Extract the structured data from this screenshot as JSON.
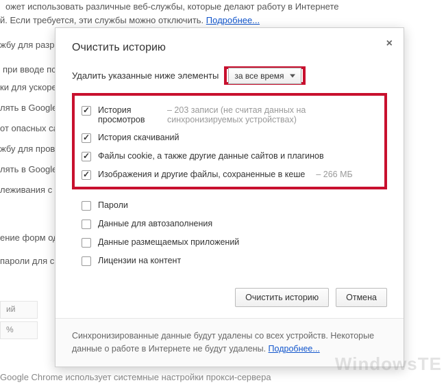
{
  "background": {
    "line1": "ожет использовать различные веб-службы, которые делают работу в Интернете",
    "line2_a": "й. Если требуется, эти службы можно отключить.",
    "line2_link": "Подробнее...",
    "side1": "жбу для разр",
    "side2": "при вводе пс",
    "side3": "ки для ускоре",
    "side4": "лять в Google",
    "side5": "от опасных са",
    "side6": "жбу для пров",
    "side7": "лять в Google",
    "side8": "леживания с",
    "side9": "ение форм од",
    "side10": "пароли для с",
    "row1": "ий",
    "row2": "%",
    "bottom": "Google Chrome использует системные настройки прокси-сервера"
  },
  "dialog": {
    "title": "Очистить историю",
    "delete_label": "Удалить указанные ниже элементы",
    "time_range": "за все время",
    "items": [
      {
        "checked": true,
        "label": "История просмотров",
        "sub": "– 203 записи (не считая данных на синхронизируемых устройствах)"
      },
      {
        "checked": true,
        "label": "История скачиваний",
        "sub": ""
      },
      {
        "checked": true,
        "label": "Файлы cookie, а также другие данные сайтов и плагинов",
        "sub": ""
      },
      {
        "checked": true,
        "label": "Изображения и другие файлы, сохраненные в кеше",
        "sub": "– 266 МБ"
      }
    ],
    "plain_items": [
      {
        "checked": false,
        "label": "Пароли"
      },
      {
        "checked": false,
        "label": "Данные для автозаполнения"
      },
      {
        "checked": false,
        "label": "Данные размещаемых приложений"
      },
      {
        "checked": false,
        "label": "Лицензии на контент"
      }
    ],
    "btn_clear": "Очистить историю",
    "btn_cancel": "Отмена",
    "footer_text": "Синхронизированные данные будут удалены со всех устройств. Некоторые данные о работе в Интернете не будут удалены.",
    "footer_link": "Подробнее..."
  },
  "watermark": "WindowsTE"
}
